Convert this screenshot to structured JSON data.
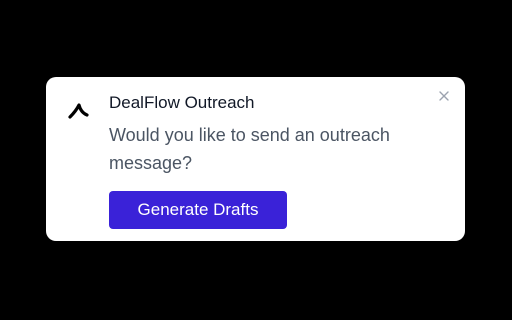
{
  "dialog": {
    "title": "DealFlow Outreach",
    "message": "Would you like to send an outreach message?",
    "primary_button_label": "Generate Drafts",
    "logo_icon": "dealflow-logo-icon",
    "close_icon": "close-icon"
  },
  "colors": {
    "background": "#000000",
    "card": "#ffffff",
    "title": "#111827",
    "message": "#4b5563",
    "accent": "#3a22d8",
    "close_icon": "#9ca3af"
  }
}
